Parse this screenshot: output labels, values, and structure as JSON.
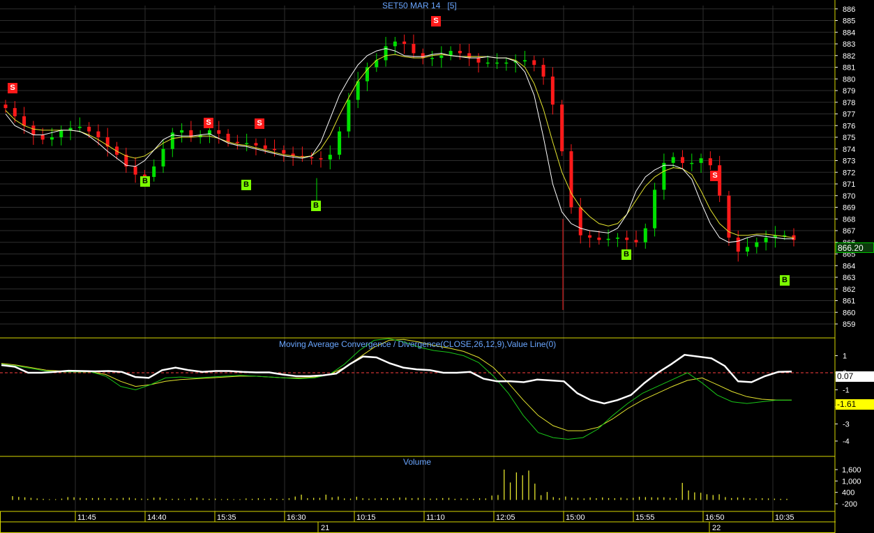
{
  "colors": {
    "background": "#000000",
    "grid": "#2e2e2e",
    "axis_border": "#d8d800",
    "candle_up": "#00e000",
    "candle_down": "#ff1a1a",
    "ma_fast": "#ffffff",
    "ma_slow": "#e6e62e",
    "macd": "#ffffff",
    "signal_fast": "#19c819",
    "signal_slow": "#e6e62e",
    "zero_line": "#ff4040",
    "volume": "#e6e62e",
    "header_text": "#6aa6ff",
    "axis_text": "#ffffff",
    "sell_badge": "#ff1a1a",
    "buy_badge": "#7cff00",
    "last_price_bg": "#00c000",
    "macd_value_bg": "#ffffff",
    "signal_value_bg": "#ffff00"
  },
  "icons": {
    "sell_marker": "red-square-letter-s",
    "buy_marker": "green-square-letter-b"
  },
  "chart_data": [
    {
      "type": "candlestick",
      "title": "SET50 MAR 14",
      "interval": "[5]",
      "price_axis": [
        859,
        860,
        861,
        862,
        863,
        864,
        865,
        866,
        867,
        868,
        869,
        870,
        871,
        872,
        873,
        874,
        875,
        876,
        877,
        878,
        879,
        880,
        881,
        882,
        883,
        884,
        885,
        886
      ],
      "time_labels": [
        "11:45",
        "14:40",
        "15:35",
        "16:30",
        "10:15",
        "11:10",
        "12:05",
        "15:00",
        "15:55",
        "16:50",
        "10:35"
      ],
      "date_labels": [
        "21",
        "22"
      ],
      "last_price": "866.20",
      "ylim": [
        858.5,
        887
      ],
      "sell_label": "S",
      "buy_label": "B",
      "close_path": [
        877.5,
        876.8,
        876,
        875.2,
        874.8,
        875,
        875.6,
        875.8,
        875.9,
        875.5,
        875,
        874.2,
        873.5,
        872.5,
        871.8,
        871.6,
        872.5,
        874,
        875.4,
        875.6,
        875,
        875.2,
        875.6,
        875.3,
        874.6,
        874.5,
        874.5,
        874.3,
        874,
        873.9,
        873.6,
        873.4,
        873.3,
        873.2,
        873.1,
        873.5,
        875.5,
        878.2,
        879.8,
        881,
        881.6,
        882.8,
        883.2,
        883,
        882.2,
        881.8,
        881.8,
        882,
        882.4,
        882.2,
        881.8,
        881.4,
        881.4,
        881.4,
        881.4,
        881.5,
        881.6,
        881.2,
        880.2,
        877.8,
        873.8,
        869,
        866.6,
        866.4,
        866.2,
        866.3,
        866.4,
        866.2,
        866,
        867.2,
        870.5,
        872.8,
        873.3,
        872.8,
        872.8,
        873.2,
        872.6,
        870,
        866.4,
        865.2,
        865.6,
        866,
        866.4,
        866.6,
        866.6,
        866.2
      ],
      "ma_fast_path": [
        877,
        876,
        875.6,
        875.2,
        875.2,
        875.4,
        875.6,
        875.6,
        875.5,
        875.1,
        874.5,
        873.8,
        873.2,
        872.6,
        872.5,
        873,
        873.9,
        874.8,
        875.2,
        875.1,
        875.1,
        875.2,
        875.3,
        874.9,
        874.5,
        874.3,
        874.2,
        874,
        873.8,
        873.6,
        873.4,
        873.3,
        873.2,
        873.4,
        874.6,
        876.6,
        878.6,
        880,
        881.2,
        882,
        882.4,
        882.6,
        882.4,
        882,
        881.9,
        881.9,
        882.1,
        882.2,
        882,
        881.9,
        881.8,
        881.8,
        881.9,
        881.8,
        881.8,
        881.5,
        880.6,
        878.6,
        875,
        871,
        868.6,
        867.6,
        867.2,
        867,
        866.9,
        866.8,
        867.2,
        868.4,
        870.4,
        871.6,
        872.2,
        872.6,
        872.6,
        872.3,
        871.4,
        869.4,
        867.6,
        866.4,
        866,
        866.1,
        866.4,
        866.6,
        866.5,
        866.4,
        866.3,
        866.3
      ],
      "ma_slow_path": [
        877.3,
        876.5,
        876,
        875.7,
        875.6,
        875.6,
        875.6,
        875.6,
        875.5,
        875.2,
        874.8,
        874.3,
        873.8,
        873.4,
        873.2,
        873.4,
        873.9,
        874.5,
        874.9,
        875,
        875,
        875.1,
        875.1,
        874.9,
        874.6,
        874.4,
        874.3,
        874.1,
        873.9,
        873.7,
        873.5,
        873.4,
        873.3,
        873.4,
        874,
        875.2,
        876.9,
        878.4,
        879.8,
        880.8,
        881.6,
        882,
        882.1,
        881.9,
        881.8,
        881.8,
        882,
        882.1,
        882,
        881.9,
        881.9,
        881.9,
        881.9,
        881.8,
        881.8,
        881.6,
        881,
        879.6,
        877.4,
        874.6,
        872,
        870.2,
        869,
        868.2,
        867.6,
        867.4,
        867.6,
        868.4,
        869.6,
        870.8,
        871.6,
        872.1,
        872.4,
        872.3,
        871.8,
        870.4,
        868.8,
        867.6,
        866.9,
        866.6,
        866.6,
        866.7,
        866.7,
        866.6,
        866.5,
        866.4
      ]
    },
    {
      "type": "line",
      "title": "Moving Average Convergence / Divergence(CLOSE,26,12,9),Value Line(0)",
      "y_ticks": [
        "1",
        "0",
        "-1",
        "-2",
        "-3",
        "-4"
      ],
      "ylim": [
        -4.8,
        2.0
      ],
      "zero_line": 0,
      "value_macd": "0.07",
      "value_signal": "-1.61",
      "macd_path": [
        0.45,
        0.35,
        0,
        0,
        0.05,
        0.12,
        0.1,
        0.08,
        0.1,
        0.05,
        -0.25,
        -0.3,
        0.15,
        0.3,
        0.15,
        0.05,
        0.1,
        0.1,
        0.05,
        0.02,
        0.02,
        -0.1,
        -0.2,
        -0.2,
        -0.15,
        -0.05,
        0.5,
        0.95,
        0.9,
        0.55,
        0.3,
        0.2,
        0.15,
        0,
        0,
        0.05,
        -0.35,
        -0.5,
        -0.5,
        -0.55,
        -0.4,
        -0.45,
        -0.5,
        -1.2,
        -1.6,
        -1.8,
        -1.6,
        -1.3,
        -0.6,
        0,
        0.5,
        1.05,
        0.95,
        0.85,
        0.4,
        -0.5,
        -0.55,
        -0.2,
        0.05,
        0.07
      ],
      "signal_fast_path": [
        0.5,
        0.4,
        0.25,
        0.1,
        0.05,
        0.05,
        0.05,
        -0.2,
        -0.8,
        -1,
        -0.7,
        -0.3,
        -0.25,
        -0.3,
        -0.25,
        -0.2,
        -0.15,
        -0.2,
        -0.25,
        -0.3,
        -0.35,
        -0.3,
        -0.1,
        0.5,
        1.3,
        1.9,
        2.0,
        1.8,
        1.5,
        1.3,
        1.2,
        1.0,
        0.6,
        -0.2,
        -1.2,
        -2.5,
        -3.5,
        -3.8,
        -3.9,
        -3.8,
        -3.3,
        -2.5,
        -1.8,
        -1.2,
        -0.8,
        -0.4,
        0,
        -0.6,
        -1.3,
        -1.7,
        -1.8,
        -1.7,
        -1.6,
        -1.61
      ],
      "signal_slow_path": [
        0.55,
        0.45,
        0.3,
        0.15,
        0.1,
        0.05,
        0.05,
        -0.1,
        -0.5,
        -0.8,
        -0.7,
        -0.5,
        -0.4,
        -0.35,
        -0.3,
        -0.25,
        -0.2,
        -0.2,
        -0.25,
        -0.3,
        -0.3,
        -0.25,
        -0.1,
        0.3,
        0.9,
        1.5,
        1.9,
        1.95,
        1.8,
        1.6,
        1.45,
        1.25,
        0.9,
        0.3,
        -0.6,
        -1.6,
        -2.5,
        -3.1,
        -3.4,
        -3.4,
        -3.2,
        -2.7,
        -2.1,
        -1.6,
        -1.2,
        -0.8,
        -0.45,
        -0.3,
        -0.7,
        -1.1,
        -1.4,
        -1.55,
        -1.6,
        -1.6
      ]
    },
    {
      "type": "bar",
      "title": "Volume",
      "y_ticks": [
        "1,600",
        "1,000",
        "400",
        "-200"
      ],
      "ylim": [
        -200,
        2200
      ],
      "values": [
        200,
        160,
        140,
        110,
        80,
        60,
        40,
        40,
        70,
        150,
        140,
        110,
        90,
        100,
        110,
        90,
        90,
        80,
        110,
        120,
        80,
        70,
        60,
        120,
        130,
        60,
        60,
        70,
        40,
        80,
        120,
        80,
        60,
        70,
        40,
        60,
        40,
        40,
        80,
        60,
        90,
        60,
        90,
        60,
        60,
        90,
        180,
        280,
        90,
        110,
        110,
        280,
        140,
        180,
        80,
        70,
        170,
        90,
        70,
        80,
        100,
        90,
        80,
        130,
        120,
        90,
        110,
        100,
        70,
        80,
        100,
        110,
        60,
        80,
        70,
        60,
        90,
        80,
        230,
        260,
        1600,
        920,
        1450,
        1300,
        1550,
        860,
        250,
        420,
        150,
        100,
        180,
        120,
        110,
        80,
        130,
        90,
        130,
        100,
        90,
        120,
        80,
        110,
        170,
        150,
        140,
        130,
        140,
        110,
        100,
        900,
        500,
        400,
        380,
        300,
        260,
        300,
        150,
        100,
        130,
        110,
        90,
        80,
        90,
        80,
        70,
        60,
        60
      ]
    }
  ]
}
